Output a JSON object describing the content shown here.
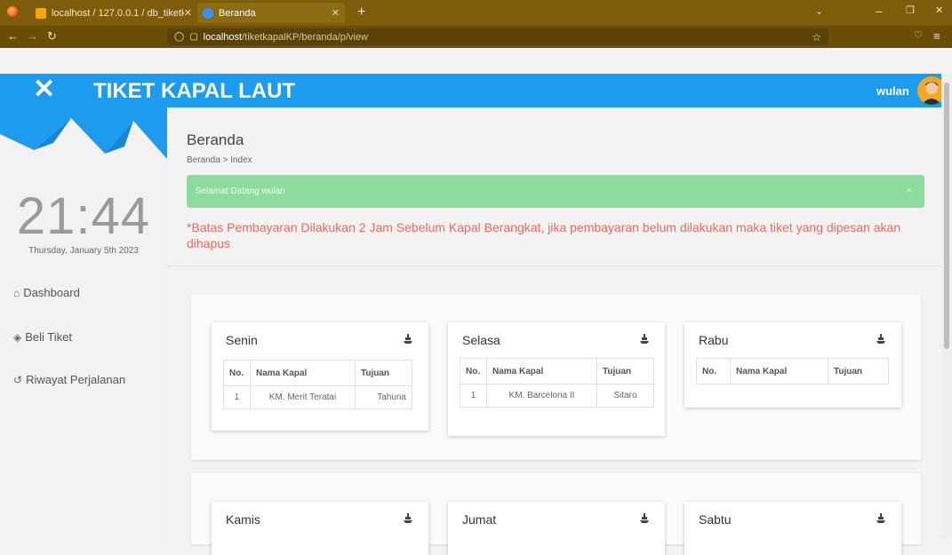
{
  "browser": {
    "tabs": [
      {
        "label": "localhost / 127.0.0.1 / db_tiketk..."
      },
      {
        "label": "Beranda"
      }
    ],
    "new_tab": "+",
    "url_host": "localhost",
    "url_path": "/tiketkapalKP/beranda/p/view",
    "colors": {
      "chrome": "#7e5d0a",
      "accent": "#1d9bef"
    }
  },
  "header": {
    "title": "TIKET KAPAL LAUT",
    "user": "wulan",
    "close": "✕"
  },
  "sidebar": {
    "clock": "21:44",
    "date": "Thursday, January 5th 2023",
    "items": [
      {
        "icon": "home-icon",
        "label": "Dashboard"
      },
      {
        "icon": "tag-icon",
        "label": "Beli Tiket"
      },
      {
        "icon": "history-icon",
        "label": "Riwayat Perjalanan"
      }
    ]
  },
  "main": {
    "title": "Beranda",
    "breadcrumb": "Beranda > Index",
    "alert": "Selamat Datang wulan",
    "alert_close": "×",
    "warning": "*Batas Pembayaran Dilakukan 2 Jam Sebelum Kapal Berangkat, jika pembayaran belum dilakukan maka tiket yang dipesan akan dihapus",
    "columns": [
      "No.",
      "Nama Kapal",
      "Tujuan"
    ],
    "days": [
      {
        "name": "Senin",
        "rows": [
          [
            "1",
            "KM. Merit Teratai",
            "Tahuna"
          ]
        ]
      },
      {
        "name": "Selasa",
        "rows": [
          [
            "1",
            "KM. Barcelona II",
            "Sitaro"
          ]
        ]
      },
      {
        "name": "Rabu",
        "rows": []
      },
      {
        "name": "Kamis",
        "rows": []
      },
      {
        "name": "Jumat",
        "rows": []
      },
      {
        "name": "Sabtu",
        "rows": []
      }
    ]
  }
}
